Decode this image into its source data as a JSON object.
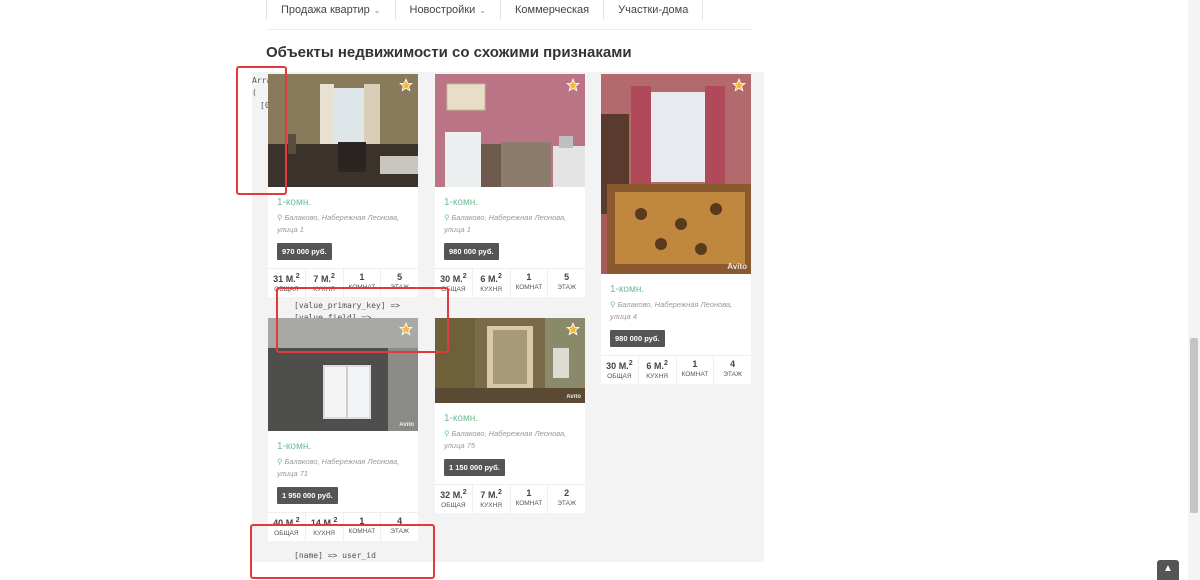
{
  "nav": {
    "items": [
      {
        "label": "Продажа квартир",
        "dropdown": true
      },
      {
        "label": "Новостройки",
        "dropdown": true
      },
      {
        "label": "Коммерческая",
        "dropdown": false
      },
      {
        "label": "Участки-дома",
        "dropdown": false
      }
    ],
    "chevron": "⌄"
  },
  "section_title": "Объекты недвижимости со схожими признаками",
  "debug": {
    "array_label": "Arra",
    "paren": "(",
    "index": "[0",
    "primary_key": "[value_primary_key] =>",
    "value_field": "[value_field] =>",
    "name_line": "[name] => user_id"
  },
  "spec_labels": {
    "area": "ОБЩАЯ",
    "kitchen": "КУХНЯ",
    "rooms": "КОМНАТ",
    "floor": "ЭТАЖ"
  },
  "area_unit": "М.",
  "area_exp": "2",
  "watermark": "Avito",
  "cards": [
    {
      "title": "1-комн.",
      "address": "Балаково, Набережная Леонова, улица 1",
      "price": "970 000 руб.",
      "area": "31",
      "kitchen": "7",
      "rooms": "1",
      "floor": "5"
    },
    {
      "title": "1-комн.",
      "address": "Балаково, Набережная Леонова, улица 1",
      "price": "980 000 руб.",
      "area": "30",
      "kitchen": "6",
      "rooms": "1",
      "floor": "5"
    },
    {
      "title": "1-комн.",
      "address": "Балаково, Набережная Леонова, улица 4",
      "price": "980 000 руб.",
      "area": "30",
      "kitchen": "6",
      "rooms": "1",
      "floor": "4"
    },
    {
      "title": "1-комн.",
      "address": "Балаково, Набережная Леонова, улица 71",
      "price": "1 950 000 руб.",
      "area": "40",
      "kitchen": "14",
      "rooms": "1",
      "floor": "4"
    },
    {
      "title": "1-комн.",
      "address": "Балаково, Набережная Леонова, улица 75",
      "price": "1 150 000 руб.",
      "area": "32",
      "kitchen": "7",
      "rooms": "1",
      "floor": "2"
    }
  ],
  "colors": {
    "accent_green": "#6dbd95",
    "price_bg": "#555555",
    "highlight_red": "#e0393e"
  },
  "to_top_icon": "▲"
}
